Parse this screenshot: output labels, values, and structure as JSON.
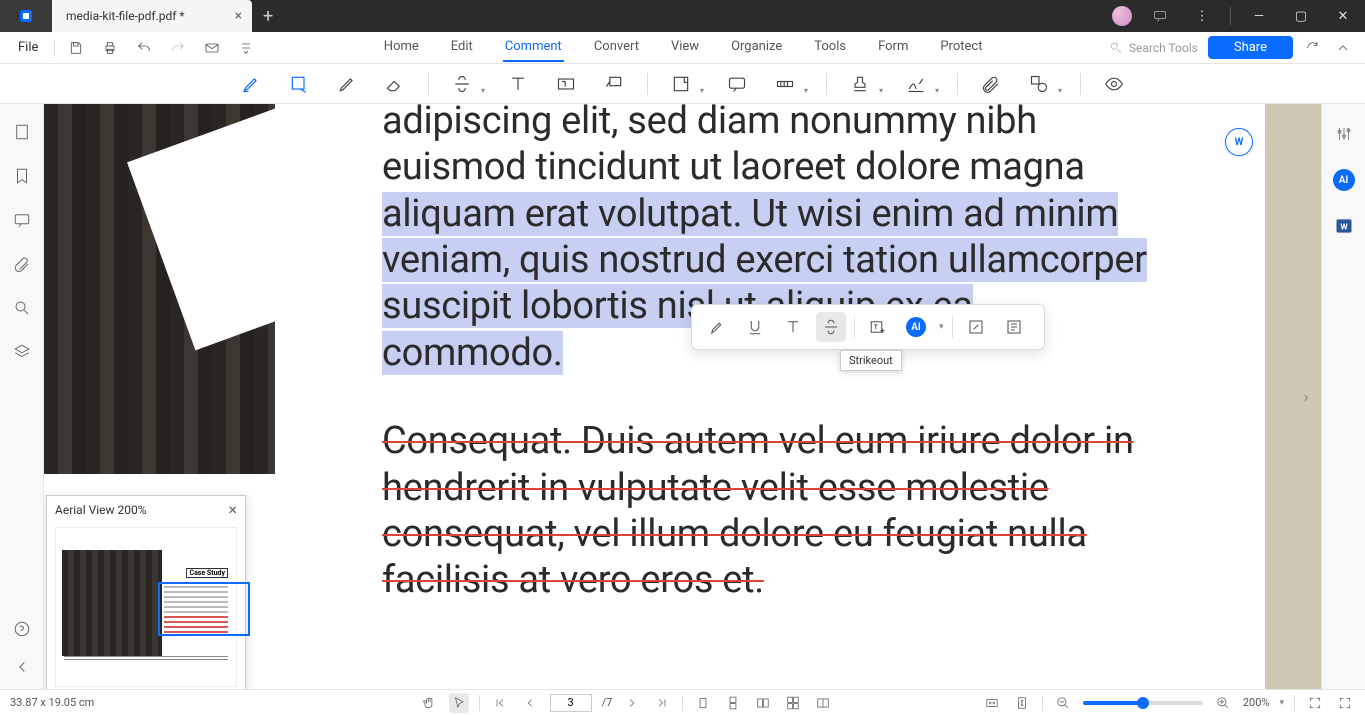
{
  "titlebar": {
    "tab_label": "media-kit-file-pdf.pdf *"
  },
  "menubar": {
    "file_label": "File",
    "items": [
      "Home",
      "Edit",
      "Comment",
      "Convert",
      "View",
      "Organize",
      "Tools",
      "Form",
      "Protect"
    ],
    "active_index": 2,
    "search_placeholder": "Search Tools",
    "share_label": "Share"
  },
  "document": {
    "para1_pre": "adipiscing elit, sed diam nonummy nibh euismod tincidunt ut laoreet dolore magna ",
    "para1_hl": "aliquam erat volutpat. Ut wisi enim ad minim veniam, quis nostrud exerci tation ullamcorper suscipit lobortis nisl ut aliquip ex ea commodo.",
    "para2": "Consequat. Duis autem vel eum iriure dolor in hendrerit in vulputate velit esse molestie consequat, vel illum dolore eu feugiat nulla facilisis at vero eros et."
  },
  "float_toolbar": {
    "tooltip": "Strikeout",
    "ai_label": "AI"
  },
  "aerial": {
    "title": "Aerial View  200%",
    "mini_title": "Case Study"
  },
  "rightbar": {
    "ai_label": "AI",
    "word_label": "W"
  },
  "word_badge": "W",
  "statusbar": {
    "coords": "33.87 x 19.05 cm",
    "current_page": "3",
    "total_pages": "/7",
    "zoom_label": "200%"
  }
}
